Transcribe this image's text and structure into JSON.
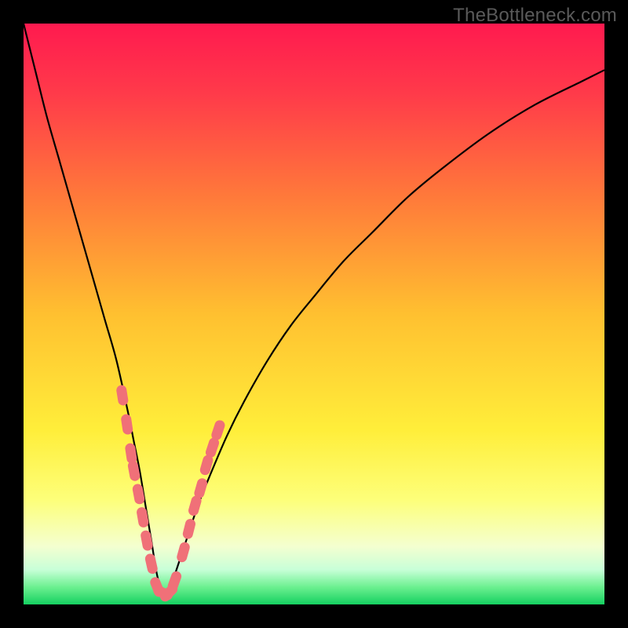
{
  "watermark": {
    "text": "TheBottleneck.com"
  },
  "colors": {
    "frame": "#000000",
    "marker_fill": "#f07078",
    "curve_stroke": "#000000",
    "gradient_stops": [
      {
        "offset": 0.0,
        "color": "#ff1a4f"
      },
      {
        "offset": 0.12,
        "color": "#ff3a4a"
      },
      {
        "offset": 0.3,
        "color": "#ff7a3a"
      },
      {
        "offset": 0.5,
        "color": "#ffc030"
      },
      {
        "offset": 0.7,
        "color": "#ffee3a"
      },
      {
        "offset": 0.82,
        "color": "#fdff7a"
      },
      {
        "offset": 0.9,
        "color": "#f4ffd0"
      },
      {
        "offset": 0.94,
        "color": "#c8ffd8"
      },
      {
        "offset": 0.97,
        "color": "#6cf090"
      },
      {
        "offset": 1.0,
        "color": "#15d060"
      }
    ]
  },
  "chart_data": {
    "type": "line",
    "title": "",
    "xlabel": "",
    "ylabel": "",
    "xlim": [
      0,
      100
    ],
    "ylim": [
      0,
      100
    ],
    "grid": false,
    "legend": false,
    "series": [
      {
        "name": "bottleneck-curve",
        "x": [
          0,
          2,
          4,
          6,
          8,
          10,
          12,
          14,
          16,
          18,
          19,
          20,
          21,
          22,
          23,
          24,
          25,
          26,
          28,
          30,
          32,
          35,
          38,
          42,
          46,
          50,
          55,
          60,
          66,
          72,
          80,
          88,
          96,
          100
        ],
        "y": [
          100,
          92,
          84,
          77,
          70,
          63,
          56,
          49,
          42,
          33,
          28,
          23,
          17,
          11,
          5,
          2,
          2,
          5,
          11,
          17,
          22,
          29,
          35,
          42,
          48,
          53,
          59,
          64,
          70,
          75,
          81,
          86,
          90,
          92
        ]
      }
    ],
    "markers": {
      "name": "highlighted-points",
      "shape": "rounded-bar",
      "points": [
        {
          "x": 17.0,
          "y": 36
        },
        {
          "x": 17.8,
          "y": 31
        },
        {
          "x": 18.5,
          "y": 26
        },
        {
          "x": 19.0,
          "y": 23
        },
        {
          "x": 19.8,
          "y": 19
        },
        {
          "x": 20.5,
          "y": 15
        },
        {
          "x": 21.2,
          "y": 11
        },
        {
          "x": 22.0,
          "y": 7
        },
        {
          "x": 23.0,
          "y": 3
        },
        {
          "x": 24.0,
          "y": 2
        },
        {
          "x": 25.0,
          "y": 2
        },
        {
          "x": 26.0,
          "y": 4
        },
        {
          "x": 27.5,
          "y": 9
        },
        {
          "x": 28.5,
          "y": 13
        },
        {
          "x": 29.5,
          "y": 17
        },
        {
          "x": 30.5,
          "y": 20
        },
        {
          "x": 31.5,
          "y": 24
        },
        {
          "x": 32.5,
          "y": 27
        },
        {
          "x": 33.5,
          "y": 30
        }
      ]
    }
  }
}
